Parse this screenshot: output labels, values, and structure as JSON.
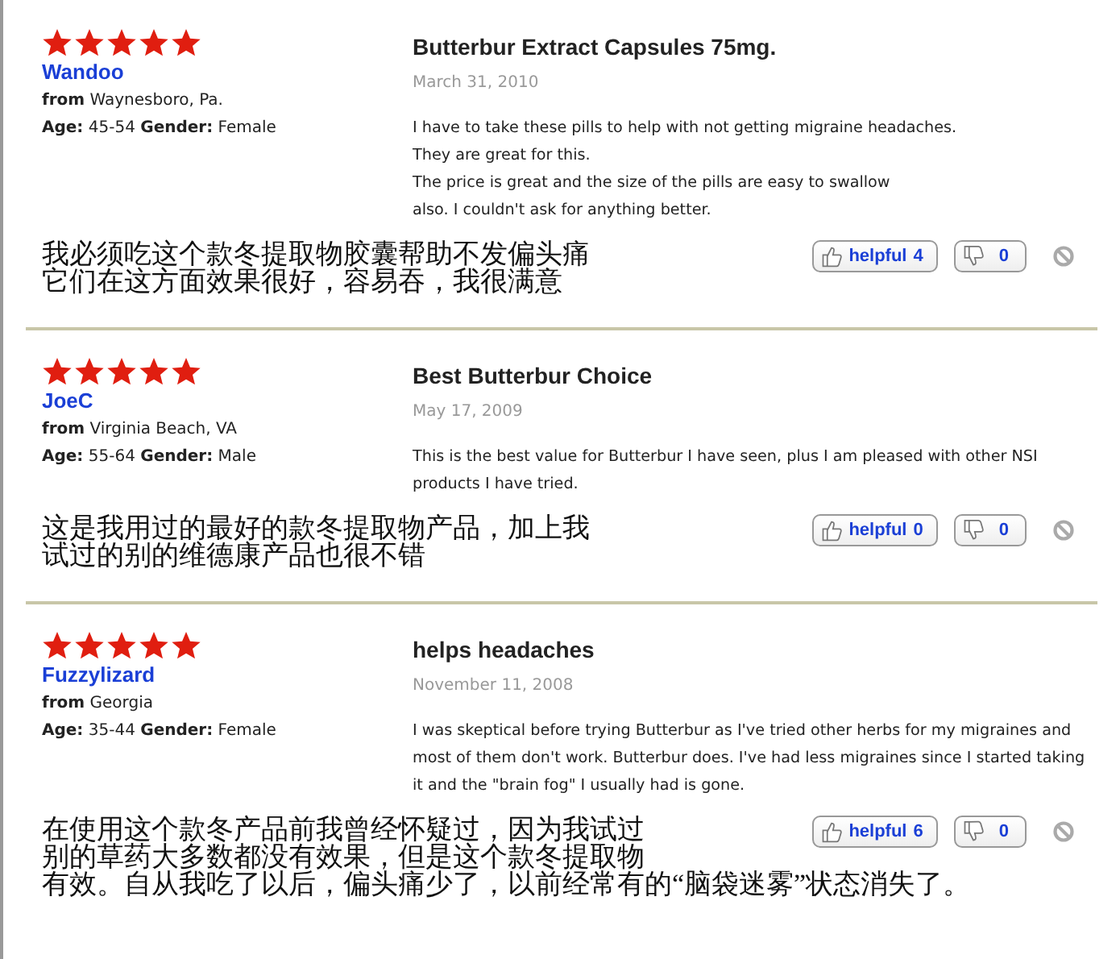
{
  "reviews": [
    {
      "stars": 5,
      "author": "Wandoo",
      "from_label": "from",
      "from": "Waynesboro, Pa.",
      "age_label": "Age:",
      "age": "45-54",
      "gender_label": "Gender:",
      "gender": "Female",
      "title": "Butterbur Extract Capsules 75mg.",
      "date": "March 31, 2010",
      "body": [
        "I have to take these pills to help with not getting migraine headaches.",
        "They are great for this.",
        "The price is great and the size of the pills are easy to swallow",
        "also. I couldn't ask for anything better."
      ],
      "note": [
        "我必须吃这个款冬提取物胶囊帮助不发偏头痛",
        "它们在这方面效果很好，容易吞，我很满意"
      ],
      "helpful_label": "helpful",
      "helpful": "4",
      "unhelpful": "0"
    },
    {
      "stars": 5,
      "author": "JoeC",
      "from_label": "from",
      "from": "Virginia Beach, VA",
      "age_label": "Age:",
      "age": "55-64",
      "gender_label": "Gender:",
      "gender": "Male",
      "title": "Best Butterbur Choice",
      "date": "May 17, 2009",
      "body": [
        "This is the best value for Butterbur I have seen, plus I am pleased with other NSI",
        "products I have tried."
      ],
      "note": [
        "这是我用过的最好的款冬提取物产品，加上我",
        "试过的别的维德康产品也很不错"
      ],
      "helpful_label": "helpful",
      "helpful": "0",
      "unhelpful": "0"
    },
    {
      "stars": 5,
      "author": "Fuzzylizard",
      "from_label": "from",
      "from": "Georgia",
      "age_label": "Age:",
      "age": "35-44",
      "gender_label": "Gender:",
      "gender": "Female",
      "title": "helps headaches",
      "date": "November 11, 2008",
      "body": [
        "I was skeptical before trying Butterbur as I've tried other herbs for my migraines and",
        "most of them don't work. Butterbur does. I've had less migraines since I started taking",
        "it and the \"brain fog\" I usually had is gone."
      ],
      "note": [
        "在使用这个款冬产品前我曾经怀疑过，因为我试过",
        "别的草药大多数都没有效果，但是这个款冬提取物",
        "有效。自从我吃了以后，偏头痛少了，以前经常有的“脑袋迷雾”状态消失了。"
      ],
      "helpful_label": "helpful",
      "helpful": "6",
      "unhelpful": "0"
    }
  ]
}
